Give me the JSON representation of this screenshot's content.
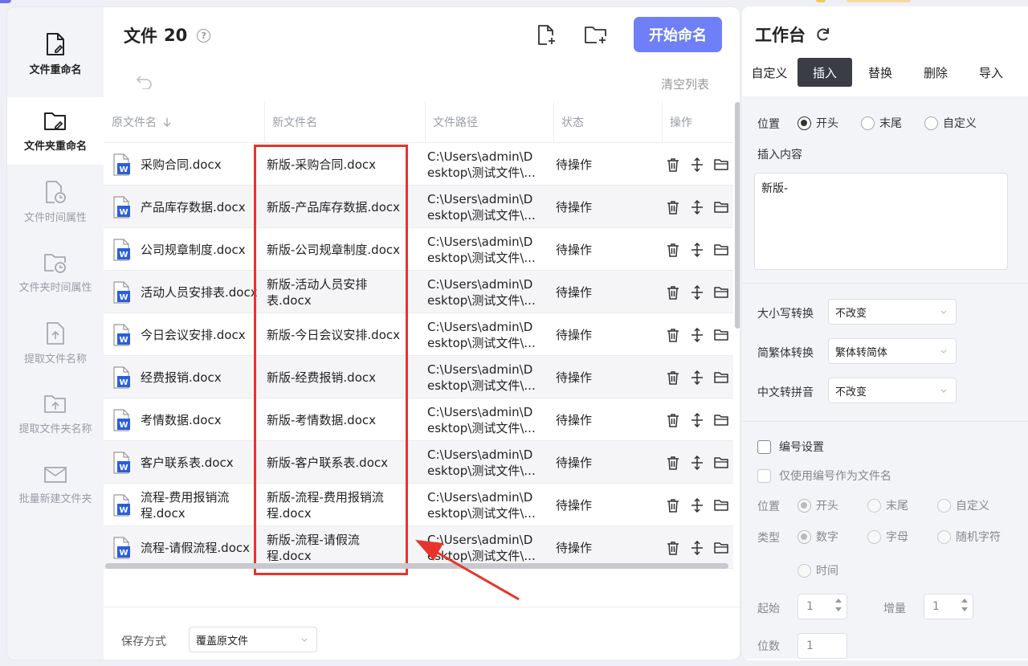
{
  "sidebar": {
    "items": [
      {
        "label": "文件重命名"
      },
      {
        "label": "文件夹重命名"
      },
      {
        "label": "文件时间属性"
      },
      {
        "label": "文件夹时间属性"
      },
      {
        "label": "提取文件名称"
      },
      {
        "label": "提取文件夹名称"
      },
      {
        "label": "批量新建文件夹"
      }
    ]
  },
  "header": {
    "title": "文件",
    "count": "20",
    "help": "?",
    "start_label": "开始命名",
    "clear_label": "清空列表"
  },
  "table": {
    "columns": [
      "原文件名",
      "新文件名",
      "文件路径",
      "状态",
      "操作"
    ],
    "rows": [
      {
        "name": "采购合同.docx",
        "new_name": "新版-采购合同.docx",
        "path": "C:\\Users\\admin\\Desktop\\测试文件\\...",
        "status": "待操作"
      },
      {
        "name": "产品库存数据.docx",
        "new_name": "新版-产品库存数据.docx",
        "path": "C:\\Users\\admin\\Desktop\\测试文件\\...",
        "status": "待操作"
      },
      {
        "name": "公司规章制度.docx",
        "new_name": "新版-公司规章制度.docx",
        "path": "C:\\Users\\admin\\Desktop\\测试文件\\...",
        "status": "待操作"
      },
      {
        "name": "活动人员安排表.docx",
        "new_name": "新版-活动人员安排表.docx",
        "path": "C:\\Users\\admin\\Desktop\\测试文件\\...",
        "status": "待操作"
      },
      {
        "name": "今日会议安排.docx",
        "new_name": "新版-今日会议安排.docx",
        "path": "C:\\Users\\admin\\Desktop\\测试文件\\...",
        "status": "待操作"
      },
      {
        "name": "经费报销.docx",
        "new_name": "新版-经费报销.docx",
        "path": "C:\\Users\\admin\\Desktop\\测试文件\\...",
        "status": "待操作"
      },
      {
        "name": "考情数据.docx",
        "new_name": "新版-考情数据.docx",
        "path": "C:\\Users\\admin\\Desktop\\测试文件\\...",
        "status": "待操作"
      },
      {
        "name": "客户联系表.docx",
        "new_name": "新版-客户联系表.docx",
        "path": "C:\\Users\\admin\\Desktop\\测试文件\\...",
        "status": "待操作"
      },
      {
        "name": "流程-费用报销流程.docx",
        "new_name": "新版-流程-费用报销流程.docx",
        "path": "C:\\Users\\admin\\Desktop\\测试文件\\...",
        "status": "待操作"
      },
      {
        "name": "流程-请假流程.docx",
        "new_name": "新版-流程-请假流程.docx",
        "path": "C:\\Users\\admin\\Desktop\\测试文件\\...",
        "status": "待操作"
      }
    ]
  },
  "footer": {
    "save_label": "保存方式",
    "save_value": "覆盖原文件"
  },
  "panel": {
    "title": "工作台",
    "tabs": [
      "自定义",
      "插入",
      "替换",
      "删除",
      "导入"
    ],
    "active_tab": "插入",
    "position_label": "位置",
    "position_options": [
      "开头",
      "末尾",
      "自定义"
    ],
    "insert_label": "插入内容",
    "insert_value": "新版-",
    "case_label": "大小写转换",
    "case_value": "不改变",
    "trad_label": "简繁体转换",
    "trad_value": "繁体转简体",
    "pinyin_label": "中文转拼音",
    "pinyin_value": "不改变",
    "numbering_label": "编号设置",
    "only_number_label": "仅使用编号作为文件名",
    "num_position_label": "位置",
    "num_position_options": [
      "开头",
      "末尾",
      "自定义"
    ],
    "type_label": "类型",
    "type_options": [
      "数字",
      "字母",
      "随机字符",
      "时间"
    ],
    "start_label": "起始",
    "start_value": "1",
    "step_label": "增量",
    "step_value": "1",
    "digits_label": "位数",
    "digits_value": "1"
  },
  "colors": {
    "accent": "#6f7ff7",
    "highlight": "#e8342a",
    "word_icon": "#2b5fd9"
  }
}
